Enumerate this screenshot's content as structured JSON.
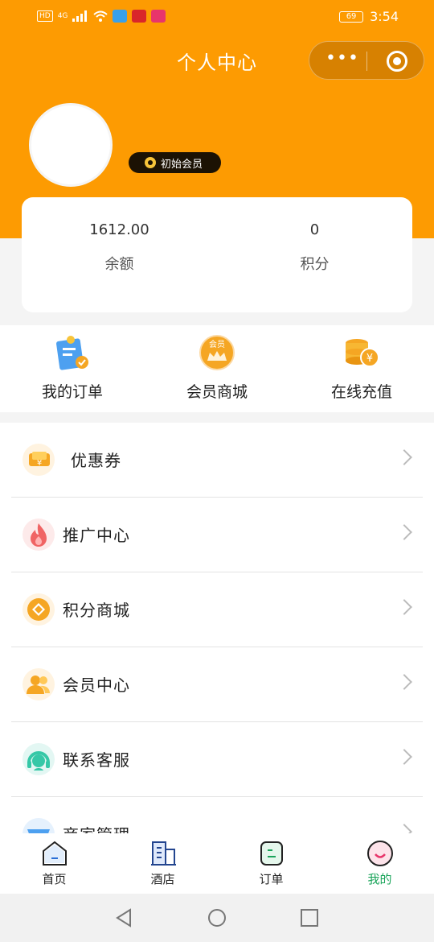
{
  "status_bar": {
    "left_chips": [
      "HD",
      "4G"
    ],
    "battery": "69",
    "time": "3:54"
  },
  "header": {
    "title": "个人中心"
  },
  "profile": {
    "member_badge": "初始会员"
  },
  "stats": [
    {
      "value": "1612.00",
      "label": "余额"
    },
    {
      "value": "0",
      "label": "积分"
    }
  ],
  "quick_actions": [
    {
      "label": "我的订单",
      "icon": "order-icon"
    },
    {
      "label": "会员商城",
      "icon": "member-mall-icon",
      "icon_text": "会员"
    },
    {
      "label": "在线充值",
      "icon": "recharge-icon",
      "icon_text": "¥"
    }
  ],
  "menu": [
    {
      "label": "优惠券",
      "icon": "coupon-icon"
    },
    {
      "label": "推广中心",
      "icon": "flame-icon"
    },
    {
      "label": "积分商城",
      "icon": "points-mall-icon"
    },
    {
      "label": "会员中心",
      "icon": "members-icon"
    },
    {
      "label": "联系客服",
      "icon": "support-icon"
    },
    {
      "label": "商家管理",
      "icon": "store-icon"
    }
  ],
  "tabs": [
    {
      "label": "首页",
      "icon": "home-icon"
    },
    {
      "label": "酒店",
      "icon": "hotel-icon"
    },
    {
      "label": "订单",
      "icon": "orders-tab-icon"
    },
    {
      "label": "我的",
      "icon": "mine-icon",
      "active": true
    }
  ],
  "colors": {
    "brand": "#fd9b02",
    "active_tab": "#1aa45a",
    "badge_bg": "#1c1204"
  }
}
